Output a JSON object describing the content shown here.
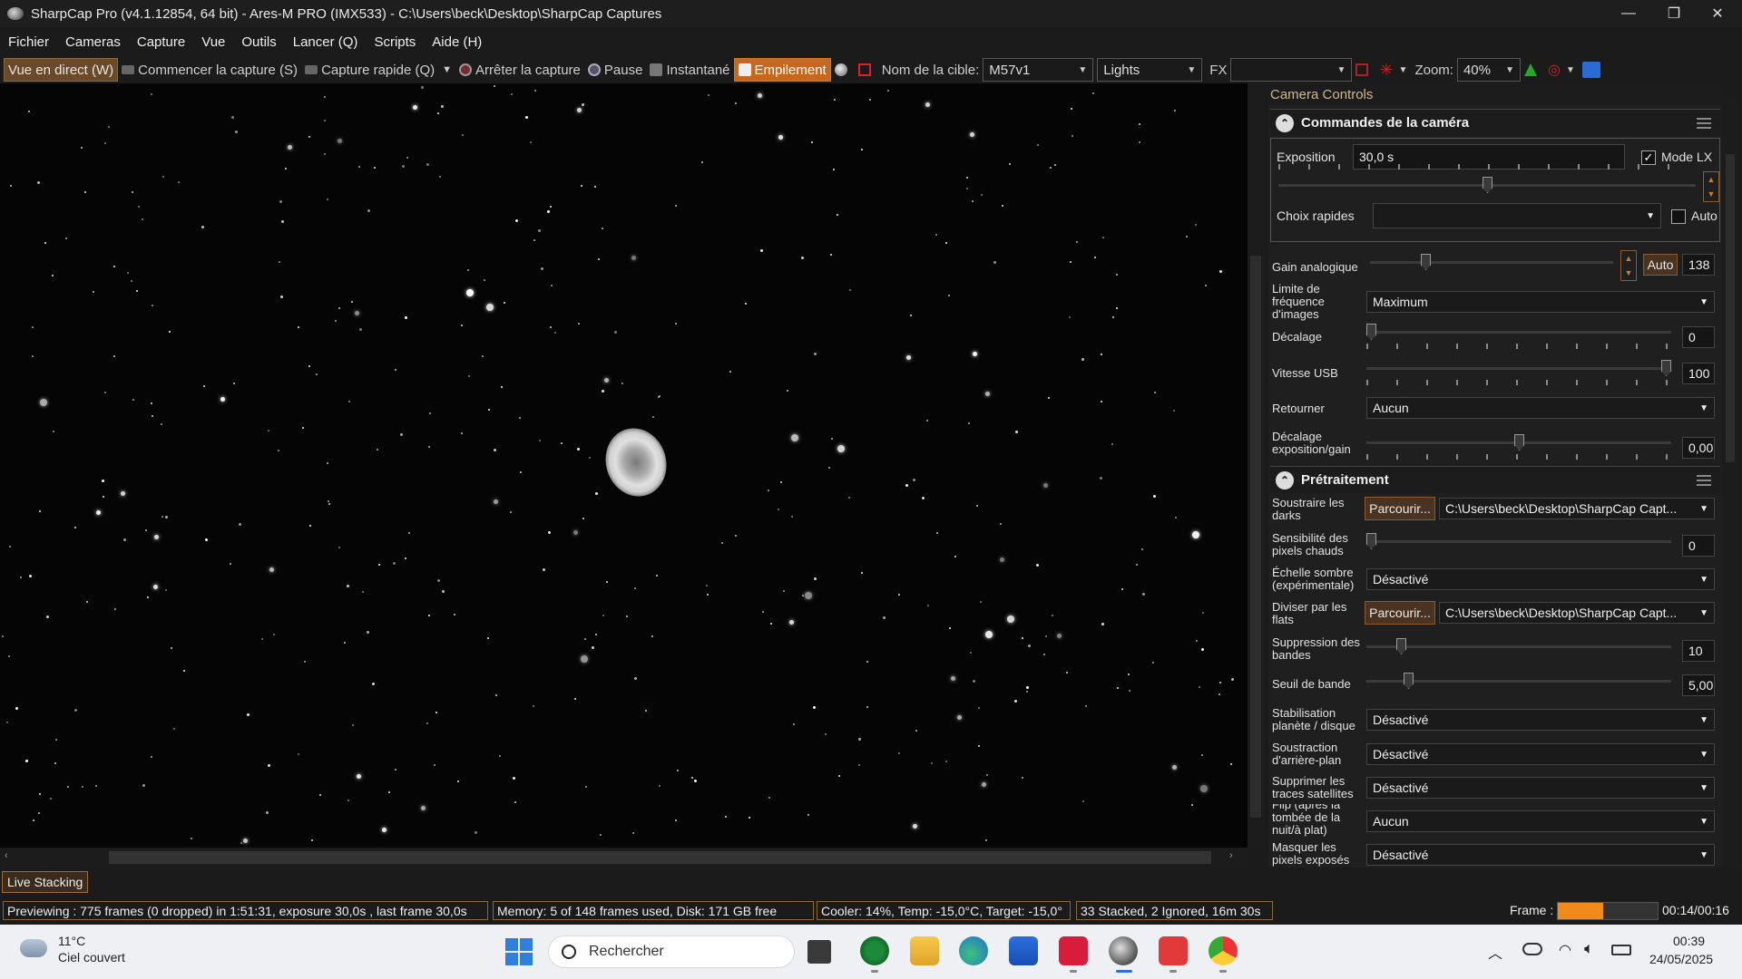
{
  "window": {
    "title": "SharpCap Pro (v4.1.12854, 64 bit) - Ares-M PRO (IMX533) - C:\\Users\\beck\\Desktop\\SharpCap Captures",
    "minimize": "—",
    "maximize": "❐",
    "close": "✕"
  },
  "menu": [
    "Fichier",
    "Cameras",
    "Capture",
    "Vue",
    "Outils",
    "Lancer (Q)",
    "Scripts",
    "Aide (H)"
  ],
  "toolbar": {
    "live_view": "Vue en direct (W)",
    "start_capture": "Commencer la capture (S)",
    "quick_capture": "Capture rapide (Q)",
    "stop_capture": "Arrêter la capture",
    "pause": "Pause",
    "snapshot": "Instantané",
    "stacking": "Empilement",
    "target_label": "Nom de la cible:",
    "target_value": "M57v1",
    "frame_type": "Lights",
    "fx_label": "FX",
    "fx_value": "",
    "zoom_label": "Zoom:",
    "zoom_value": "40%"
  },
  "panel": {
    "header": "Camera Controls",
    "camera_section": {
      "title": "Commandes de la caméra",
      "exposure_label": "Exposition",
      "exposure_value": "30,0 s",
      "lx_mode_label": "Mode LX",
      "lx_mode_checked": true,
      "quick_choice_label": "Choix rapides",
      "quick_choice_value": "",
      "auto_label": "Auto",
      "gain_label": "Gain analogique",
      "gain_auto": "Auto",
      "gain_value": "138",
      "frame_limit_label": "Limite de fréquence d'images",
      "frame_limit_value": "Maximum",
      "offset_label": "Décalage",
      "offset_value": "0",
      "usb_label": "Vitesse USB",
      "usb_value": "100",
      "flip_label": "Retourner",
      "flip_value": "Aucun",
      "exp_gain_offset_label": "Décalage exposition/gain",
      "exp_gain_offset_value": "0,00"
    },
    "preprocess_section": {
      "title": "Prétraitement",
      "darks_label": "Soustraire les darks",
      "browse": "Parcourir...",
      "darks_path": "C:\\Users\\beck\\Desktop\\SharpCap Capt...",
      "hot_pixel_label": "Sensibilité des pixels chauds",
      "hot_pixel_value": "0",
      "dark_scale_label": "Échelle sombre (expérimentale)",
      "dark_scale_value": "Désactivé",
      "flats_label": "Diviser par les flats",
      "flats_path": "C:\\Users\\beck\\Desktop\\SharpCap Capt...",
      "banding_label": "Suppression des bandes",
      "banding_value": "10",
      "band_threshold_label": "Seuil de bande",
      "band_threshold_value": "5,00",
      "stabilize_label": "Stabilisation planète / disque",
      "stabilize_value": "Désactivé",
      "bg_sub_label": "Soustraction d'arrière-plan",
      "bg_sub_value": "Désactivé",
      "sat_trails_label": "Supprimer les traces satellites",
      "sat_trails_value": "Désactivé",
      "flip_after_label": "Flip (après la tombée de la nuit/à plat)",
      "flip_after_value": "Aucun",
      "mask_label": "Masquer les pixels exposés",
      "mask_value": "Désactivé"
    }
  },
  "live_stacking_tab": "Live Stacking",
  "status": {
    "preview": "Previewing : 775 frames (0 dropped) in 1:51:31, exposure 30,0s , last frame 30,0s",
    "memory": "Memory: 5 of 148 frames used, Disk: 171 GB free",
    "cooler": "Cooler: 14%, Temp: -15,0°C, Target: -15,0°",
    "stacked": "33 Stacked, 2 Ignored, 16m 30s",
    "frame_label": "Frame :",
    "frame_progress": 0.45,
    "frame_time": "00:14/00:16"
  },
  "taskbar": {
    "weather_temp": "11°C",
    "weather_desc": "Ciel couvert",
    "search_placeholder": "Rechercher",
    "time": "00:39",
    "date": "24/05/2025"
  },
  "colors": {
    "accent": "#c9681d",
    "status_border": "#8a6a30",
    "panel_header": "#cdb88c"
  }
}
